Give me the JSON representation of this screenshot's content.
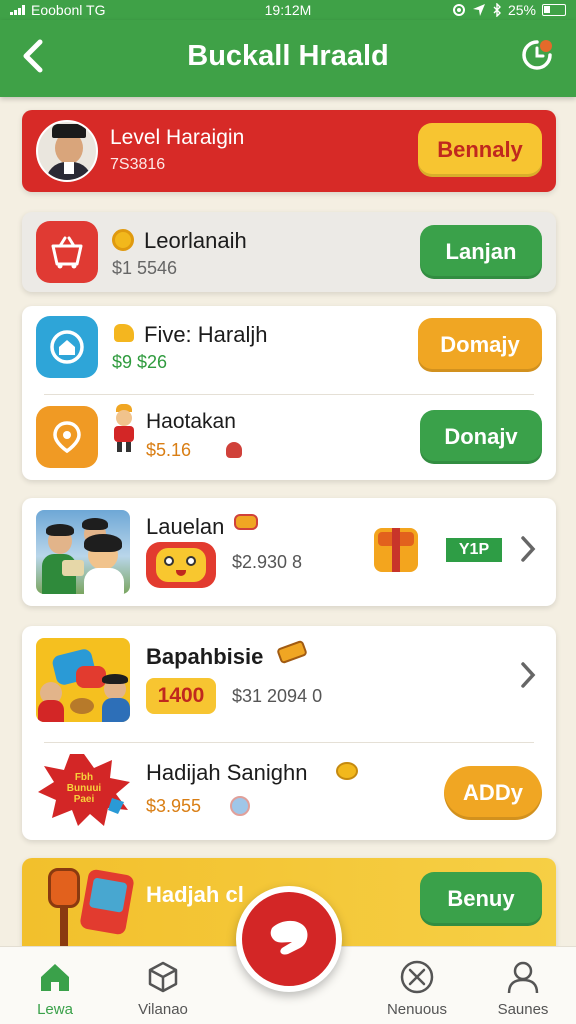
{
  "status_bar": {
    "carrier": "Eoobonl TG",
    "time": "19:12M",
    "battery": "25%"
  },
  "header": {
    "title": "Buckall Hraald",
    "back_icon": "chevron-left-icon",
    "action_icon": "refresh-badge-icon"
  },
  "profile_card": {
    "name": "Level Haraigin",
    "points": "7S3816",
    "button_label": "Bennaly",
    "bg_color": "#d72a27",
    "button_color": "#f7c531"
  },
  "items": [
    {
      "title": "Leorlanaih",
      "price": "$1 5546",
      "button_label": "Lanjan",
      "button_color": "#3aa14a",
      "icon": "shopping-basket-icon"
    },
    {
      "title": "Five: Haraljh",
      "price": "$9  $26",
      "button_label": "Domajy",
      "button_color": "#f0a623",
      "icon": "home-camera-icon"
    },
    {
      "title": "Haotakan",
      "price": "$5.16",
      "button_label": "Donajv",
      "button_color": "#3aa14a",
      "icon": "location-pin-icon"
    }
  ],
  "feature_card": {
    "title": "Lauelan",
    "price": "$2.930 8",
    "tag": "Y1P"
  },
  "bundle_card": {
    "item1_title": "Bapahbisie",
    "item1_badge": "1400",
    "item1_price": "$31 2094 0",
    "item2_title": "Hadijah Sanighn",
    "item2_price": "$3.955",
    "item2_button": "ADDy",
    "item2_burst_text": "Fbh Bunuui Paei"
  },
  "promo_card": {
    "title": "Hadjah cl",
    "button_label": "Benuy"
  },
  "bottom_nav": {
    "items": [
      {
        "label": "Lewa",
        "icon": "home-icon"
      },
      {
        "label": "Vilanao",
        "icon": "cube-icon"
      },
      {
        "label": "Nenuous",
        "icon": "close-circle-icon"
      },
      {
        "label": "Saunes",
        "icon": "user-icon"
      }
    ]
  }
}
